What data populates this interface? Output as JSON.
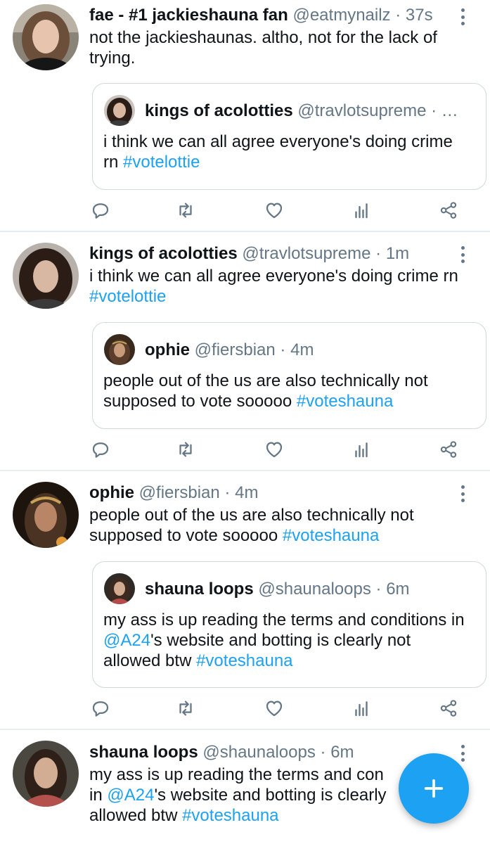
{
  "tweets": [
    {
      "name": "fae - #1 jackieshauna fan",
      "handle": "@eatmynailz",
      "time": "37s",
      "text": "not the jackieshaunas. altho, not for the lack of trying.",
      "quote": {
        "name": "kings of acolotties",
        "handle": "@travlotsupreme",
        "time": "· …",
        "text": "i think we can all agree everyone's doing crime rn ",
        "hashtag": "#votelottie"
      }
    },
    {
      "name": "kings of acolotties",
      "handle": "@travlotsupreme",
      "time": "1m",
      "text": "i think we can all agree everyone's doing crime rn ",
      "hashtag": "#votelottie",
      "quote": {
        "name": "ophie",
        "handle": "@fiersbian",
        "time": "4m",
        "text": "people out of the us are also technically not supposed to vote sooooo ",
        "hashtag": "#voteshauna"
      }
    },
    {
      "name": "ophie",
      "handle": "@fiersbian",
      "time": "4m",
      "text": "people out of the us are also technically not supposed to vote sooooo ",
      "hashtag": "#voteshauna",
      "quote": {
        "name": "shauna loops",
        "handle": "@shaunaloops",
        "time": "6m",
        "text_a": "my ass is up reading the terms and conditions in ",
        "mention": "@A24",
        "text_b": "'s website and botting is clearly not allowed btw ",
        "hashtag": "#voteshauna"
      }
    },
    {
      "name": "shauna loops",
      "handle": "@shaunaloops",
      "time": "6m",
      "text_a": "my ass is up reading the terms and con",
      "line2_a": "in ",
      "mention": "@A24",
      "line2_b": "'s website and botting is clearly",
      "line3_a": "allowed btw ",
      "hashtag": "#voteshauna"
    }
  ],
  "separator": "·",
  "actions": {
    "reply_icon": "reply-icon",
    "retweet_icon": "retweet-icon",
    "like_icon": "heart-icon",
    "analytics_icon": "analytics-icon",
    "share_icon": "share-icon"
  },
  "compose": {
    "icon": "plus-icon"
  },
  "colors": {
    "link": "#1da1f2",
    "meta": "#657786",
    "border": "#cfd9de",
    "fab": "#1da1f2"
  }
}
